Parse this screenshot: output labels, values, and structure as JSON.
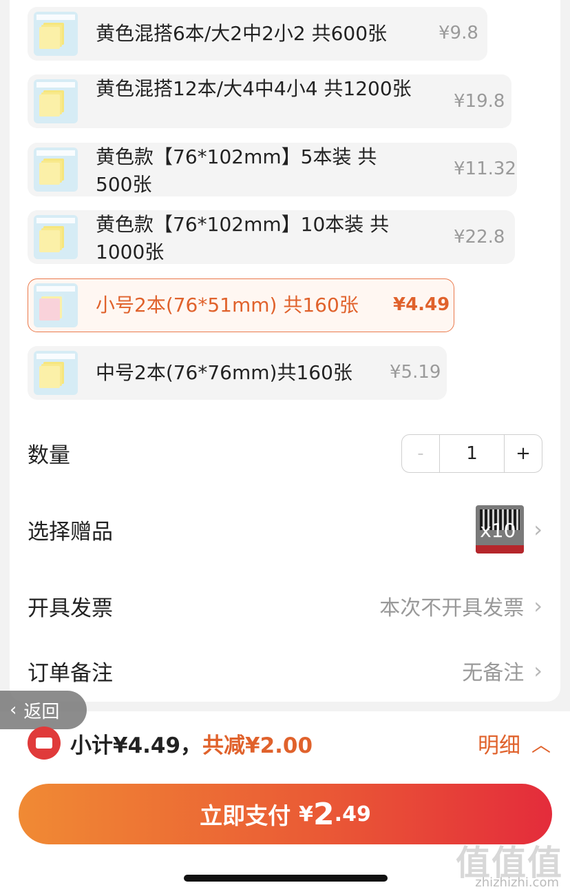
{
  "variants": [
    {
      "label": "黄色混搭6本/大2中2小2 共600张",
      "price": "¥9.8",
      "selected": false
    },
    {
      "label": "黄色混搭12本/大4中4小4 共1200张",
      "price": "¥19.8",
      "selected": false
    },
    {
      "label": "黄色款【76*102mm】5本装 共500张",
      "price": "¥11.32",
      "selected": false
    },
    {
      "label": "黄色款【76*102mm】10本装 共1000张",
      "price": "¥22.8",
      "selected": false
    },
    {
      "label": "小号2本(76*51mm) 共160张",
      "price": "¥4.49",
      "selected": true
    },
    {
      "label": "中号2本(76*76mm)共160张",
      "price": "¥5.19",
      "selected": false
    }
  ],
  "quantity": {
    "label": "数量",
    "minus": "-",
    "value": "1",
    "plus": "+"
  },
  "gift": {
    "label": "选择赠品",
    "badge": "x10"
  },
  "invoice": {
    "label": "开具发票",
    "value": "本次不开具发票"
  },
  "note": {
    "label": "订单备注",
    "value": "无备注"
  },
  "back": {
    "label": "返回"
  },
  "summary": {
    "subtotal": "小计¥4.49，",
    "discount": "共减¥2.00",
    "detail": "明细"
  },
  "pay": {
    "label": "立即支付",
    "currency": "¥",
    "integer": "2",
    "decimal": ".49"
  },
  "watermark": {
    "text": "值值值",
    "site": "zhizhizhi.com"
  },
  "colors": {
    "accent": "#e0622c",
    "button_start": "#f08a34",
    "button_end": "#e42c3b"
  }
}
